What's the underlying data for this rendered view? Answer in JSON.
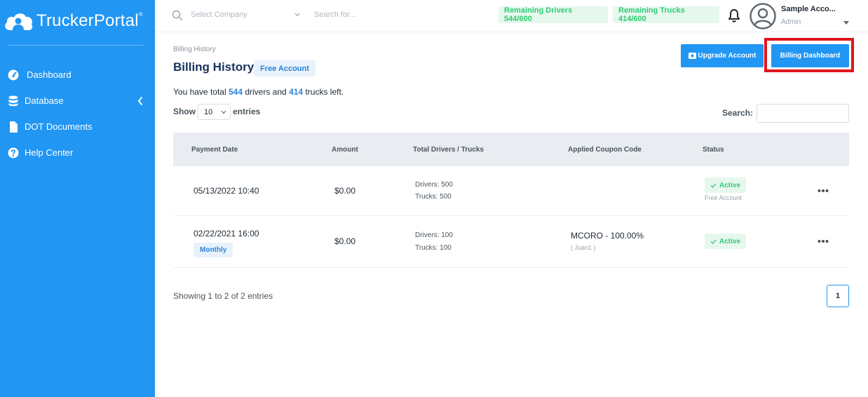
{
  "brand": {
    "name": "TruckerPortal",
    "mark": "®"
  },
  "sidebar": {
    "items": [
      {
        "label": "Dashboard"
      },
      {
        "label": "Database"
      },
      {
        "label": "DOT Documents"
      },
      {
        "label": "Help Center"
      }
    ]
  },
  "topbar": {
    "company_placeholder": "Select Company",
    "search_placeholder": "Search for...",
    "remaining_drivers": "Remaining Drivers 544/600",
    "remaining_trucks": "Remaining Trucks 414/600",
    "user_name": "Sample Acco...",
    "user_role": "Admin"
  },
  "page": {
    "breadcrumb": "Billing History",
    "title": "Billing History",
    "account_badge": "Free Account",
    "upgrade_button": "Upgrade Account",
    "billing_button": "Billing Dashboard",
    "summary": {
      "prefix": "You have total",
      "drivers": "544",
      "middle": "drivers and",
      "trucks": "414",
      "suffix": "trucks left."
    },
    "show_label": "Show",
    "entries_per_page": "10",
    "entries_label": "entries",
    "search_label": "Search:"
  },
  "table": {
    "headers": [
      "Payment Date",
      "Amount",
      "Total Drivers / Trucks",
      "Applied Coupon Code",
      "Status"
    ],
    "rows": [
      {
        "date": "05/13/2022 10:40",
        "plan": "",
        "amount": "$0.00",
        "drivers": "Drivers: 500",
        "trucks": "Trucks: 500",
        "coupon": "",
        "coupon_user": "",
        "status": "Active",
        "status_note": "Free Account"
      },
      {
        "date": "02/22/2021 16:00",
        "plan": "Monthly",
        "amount": "$0.00",
        "drivers": "Drivers: 100",
        "trucks": "Trucks: 100",
        "coupon": "MCORO - 100.00%",
        "coupon_user": "( Juan1 )",
        "status": "Active",
        "status_note": ""
      }
    ]
  },
  "footer": {
    "showing": "Showing 1 to 2 of 2 entries",
    "page": "1"
  },
  "colors": {
    "sidebar": "#2196f3",
    "accent": "#2196f3",
    "success": "#2ecc71",
    "title": "#17325c",
    "highlight": "#e0161e"
  }
}
